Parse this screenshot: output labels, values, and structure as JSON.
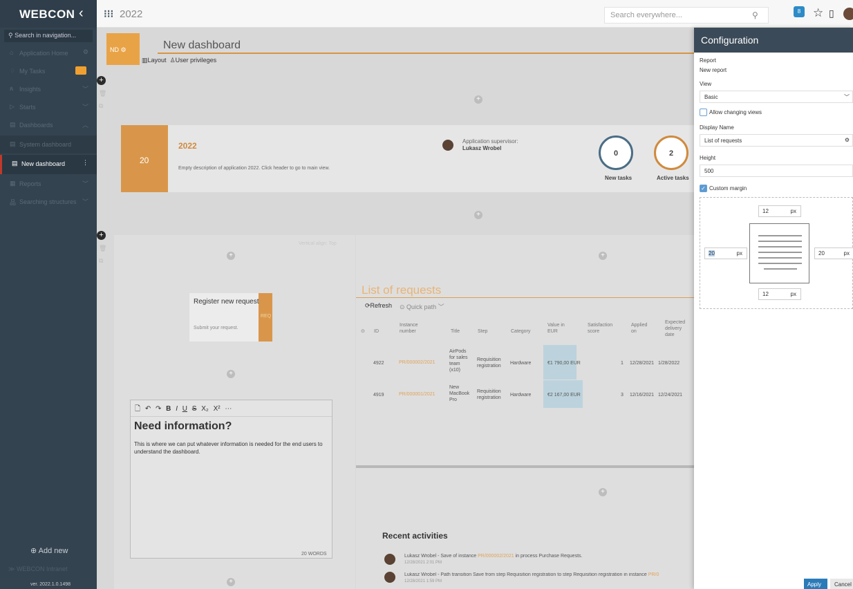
{
  "app": {
    "logo": "WEBCON",
    "title": "2022",
    "search_placeholder": "Search everywhere...",
    "notif_count": "8"
  },
  "sidebar": {
    "search": "Search in navigation...",
    "items": [
      {
        "label": "Application Home",
        "icon": "home-icon"
      },
      {
        "label": "My Tasks",
        "icon": "bell-icon"
      },
      {
        "label": "Insights",
        "icon": "people-icon"
      },
      {
        "label": "Starts",
        "icon": "play-icon"
      },
      {
        "label": "Dashboards",
        "icon": "dashboard-icon"
      },
      {
        "label": "System dashboard",
        "icon": "dashboard-icon"
      },
      {
        "label": "New dashboard",
        "icon": "dashboard-icon"
      },
      {
        "label": "Reports",
        "icon": "grid-icon"
      },
      {
        "label": "Searching structures",
        "icon": "tree-icon"
      }
    ],
    "add_new": "Add new",
    "intranet": "WEBCON Intranet",
    "version": "ver. 2022.1.0.1498"
  },
  "dashboard": {
    "tile": "ND",
    "name": "New dashboard",
    "tabs": {
      "layout": "Layout",
      "privileges": "User privileges"
    }
  },
  "app_card": {
    "number": "20",
    "title": "2022",
    "description": "Empty description of application 2022. Click header to go to main view.",
    "supervisor_label": "Application supervisor:",
    "supervisor": "Lukasz Wrobel",
    "new_tasks": {
      "count": "0",
      "label": "New tasks"
    },
    "active_tasks": {
      "count": "2",
      "label": "Active tasks"
    }
  },
  "left": {
    "valign": "Vertical align: Top",
    "register": {
      "title": "Register new request",
      "desc": "Submit your request.",
      "tag": "REQ"
    },
    "editor": {
      "heading": "Need information?",
      "body": "This is where we can put whatever information is needed for the end users to understand the dashboard.",
      "words": "20 WORDS"
    }
  },
  "report": {
    "title": "List of requests",
    "refresh": "Refresh",
    "quick_path": "Quick path",
    "columns": [
      "ID",
      "Instance number",
      "Title",
      "Step",
      "Category",
      "Value in EUR",
      "Satisfaction score",
      "Applied on",
      "Expected delivery date"
    ],
    "rows": [
      {
        "id": "4922",
        "instance": "PR/000002/2021",
        "title": "AirPods for sales team (x10)",
        "step": "Requisition registration",
        "category": "Hardware",
        "value": "€1 790,00 EUR",
        "score": "1",
        "applied": "12/28/2021",
        "expected": "1/28/2022"
      },
      {
        "id": "4919",
        "instance": "PR/000001/2021",
        "title": "New MacBook Pro",
        "step": "Requisition registration",
        "category": "Hardware",
        "value": "€2 167,00 EUR",
        "score": "3",
        "applied": "12/16/2021",
        "expected": "12/24/2021"
      }
    ]
  },
  "activities": {
    "title": "Recent activities",
    "items": [
      {
        "user": "Lukasz Wrobel",
        "text": " - Save of instance ",
        "link": "PR/000002/2021",
        "rest": " in process  Purchase Requests.",
        "time": "12/28/2021 2:01 PM"
      },
      {
        "user": "Lukasz Wrobel",
        "text": " - Path transition  Save  from step  Requisition registration  to step  Requisition registration  in instance ",
        "link": "PR/0",
        "rest": "",
        "time": "12/28/2021 1:59 PM"
      }
    ]
  },
  "config": {
    "title": "Configuration",
    "report_label": "Report",
    "report_value": "New report",
    "view_label": "View",
    "view_value": "Basic",
    "allow_views": "Allow changing views",
    "display_name_label": "Display Name",
    "display_name": "List of requests",
    "height_label": "Height",
    "height": "500",
    "custom_margin": "Custom margin",
    "margin": {
      "top": "12",
      "bottom": "12",
      "left": "20",
      "right": "20",
      "unit": "px"
    },
    "apply": "Apply",
    "cancel": "Cancel"
  }
}
